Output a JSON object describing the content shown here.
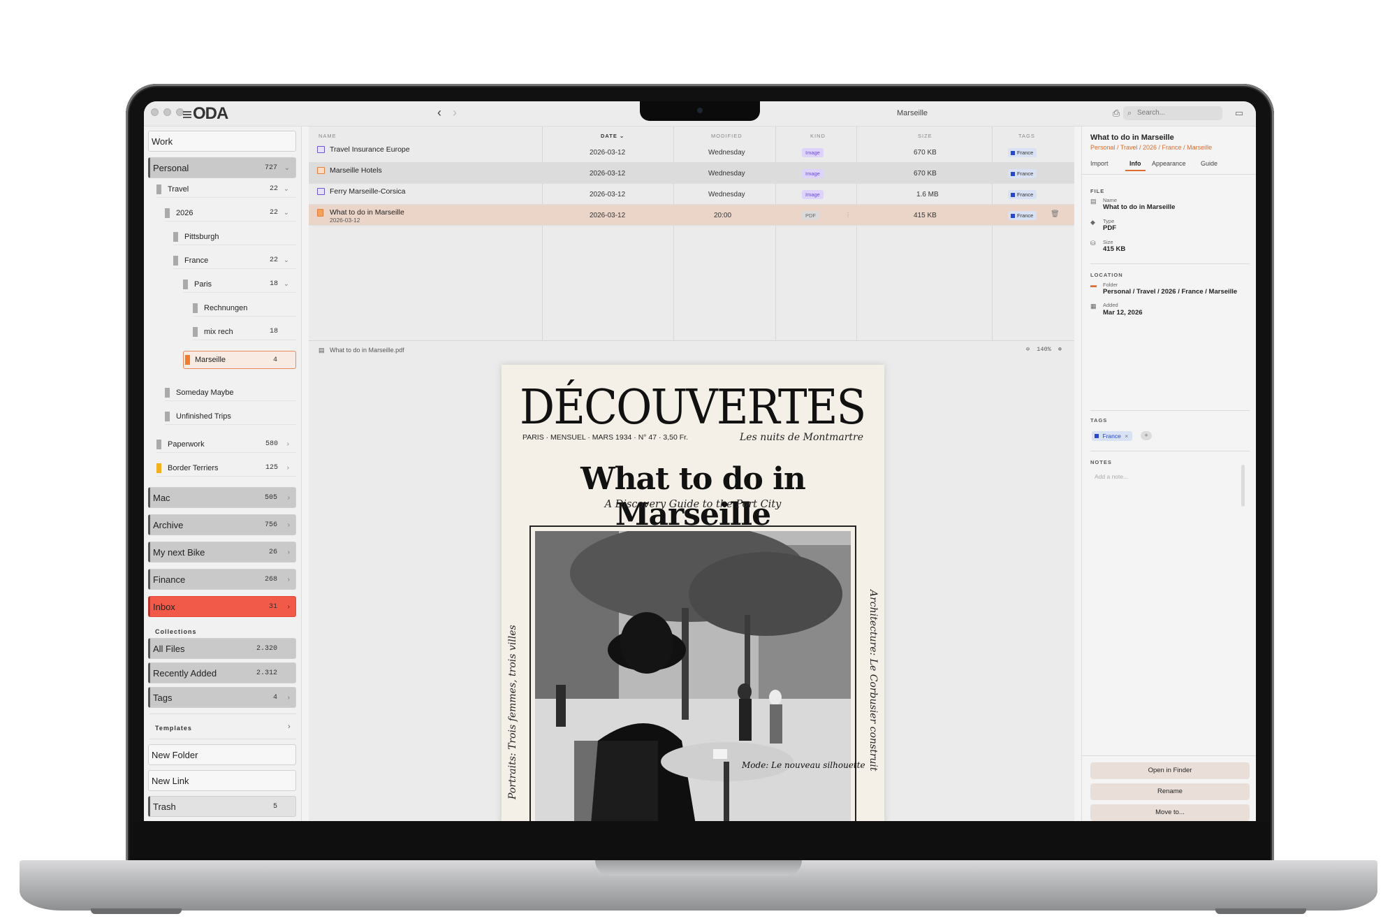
{
  "app": {
    "logo": "ODA",
    "window_title": "Marseille",
    "search_placeholder": "Search..."
  },
  "sidebar": {
    "top": [
      {
        "label": "Work"
      },
      {
        "label": "Personal",
        "count": "727",
        "chevron": "⌄"
      }
    ],
    "tree": [
      {
        "label": "Travel",
        "count": "22",
        "chevron": "⌄"
      },
      {
        "label": "2026",
        "count": "22",
        "chevron": "⌄"
      },
      {
        "label": "Pittsburgh",
        "count": "",
        "chevron": ""
      },
      {
        "label": "France",
        "count": "22",
        "chevron": "⌄"
      },
      {
        "label": "Paris",
        "count": "18",
        "chevron": "⌄"
      },
      {
        "label": "Rechnungen",
        "count": "",
        "chevron": ""
      },
      {
        "label": "mix rech",
        "count": "18",
        "chevron": ""
      },
      {
        "label": "Marseille",
        "count": "4",
        "chevron": ""
      },
      {
        "label": "Someday Maybe",
        "count": "",
        "chevron": ""
      },
      {
        "label": "Unfinished Trips",
        "count": "",
        "chevron": ""
      },
      {
        "label": "Paperwork",
        "count": "580",
        "chevron": "›"
      },
      {
        "label": "Border Terriers",
        "count": "125",
        "chevron": "›"
      }
    ],
    "groups": [
      {
        "label": "Mac",
        "count": "505"
      },
      {
        "label": "Archive",
        "count": "756"
      },
      {
        "label": "My next Bike",
        "count": "26"
      },
      {
        "label": "Finance",
        "count": "268"
      },
      {
        "label": "Inbox",
        "count": "31"
      }
    ],
    "collections_label": "Collections",
    "collections": [
      {
        "label": "All Files",
        "count": "2.320"
      },
      {
        "label": "Recently Added",
        "count": "2.312"
      },
      {
        "label": "Tags",
        "count": "4"
      }
    ],
    "templates_label": "Templates",
    "actions": [
      {
        "label": "New Folder"
      },
      {
        "label": "New Link"
      },
      {
        "label": "Trash",
        "count": "5"
      }
    ],
    "colors": {
      "selected_folder": "#f07c2e",
      "border_terriers": "#f2b01e",
      "inbox": "#f15a48"
    }
  },
  "file_list": {
    "headers": {
      "name": "NAME",
      "date": "DATE ⌄",
      "modified": "MODIFIED",
      "kind": "KIND",
      "size": "SIZE",
      "tags": "TAGS"
    },
    "rows": [
      {
        "name": "Travel Insurance Europe",
        "sub": "",
        "date": "2026-03-12",
        "modified": "Wednesday",
        "kind": "Image",
        "size": "670 KB",
        "tag": "France"
      },
      {
        "name": "Marseille Hotels",
        "sub": "",
        "date": "2026-03-12",
        "modified": "Wednesday",
        "kind": "Image",
        "size": "670 KB",
        "tag": "France"
      },
      {
        "name": "Ferry Marseille-Corsica",
        "sub": "",
        "date": "2026-03-12",
        "modified": "Wednesday",
        "kind": "Image",
        "size": "1.6 MB",
        "tag": "France"
      },
      {
        "name": "What to do in Marseille",
        "sub": "2026-03-12",
        "date": "2026-03-12",
        "modified": "20:00",
        "kind": "PDF",
        "size": "415 KB",
        "tag": "France"
      }
    ]
  },
  "preview": {
    "filename": "What to do in Marseille.pdf",
    "zoom": "140%",
    "document": {
      "masthead": "DÉCOUVERTES",
      "issue_line": "PARIS · MENSUEL · MARS 1934 · N° 47 · 3,50 Fr.",
      "masthead_sub": "Les nuits de Montmartre",
      "headline": "What to do in Marseille",
      "subhead": "A Discovery Guide to the Port City",
      "side_left": "Portraits: Trois femmes, trois villes",
      "side_right": "Architecture: Le Corbusier construit",
      "caption": "Mode: Le nouveau silhouette"
    }
  },
  "inspector": {
    "title": "What to do in Marseille",
    "path": "Personal / Travel / 2026 / France / Marseille",
    "tabs": [
      "Import",
      "Info",
      "Appearance",
      "Guide"
    ],
    "active_tab": "Info",
    "file_section": "FILE",
    "file": [
      {
        "key": "Name",
        "value": "What to do in Marseille"
      },
      {
        "key": "Type",
        "value": "PDF"
      },
      {
        "key": "Size",
        "value": "415 KB"
      }
    ],
    "location_section": "LOCATION",
    "location": [
      {
        "key": "Folder",
        "value": "Personal / Travel / 2026 / France / Marseille"
      },
      {
        "key": "Added",
        "value": "Mar 12, 2026"
      }
    ],
    "tags_section": "TAGS",
    "tag": "France",
    "tag_remove": "×",
    "tag_add": "+",
    "notes_section": "NOTES",
    "notes_placeholder": "Add a note...",
    "buttons": {
      "open": "Open in Finder",
      "rename": "Rename",
      "move": "Move to..."
    }
  }
}
